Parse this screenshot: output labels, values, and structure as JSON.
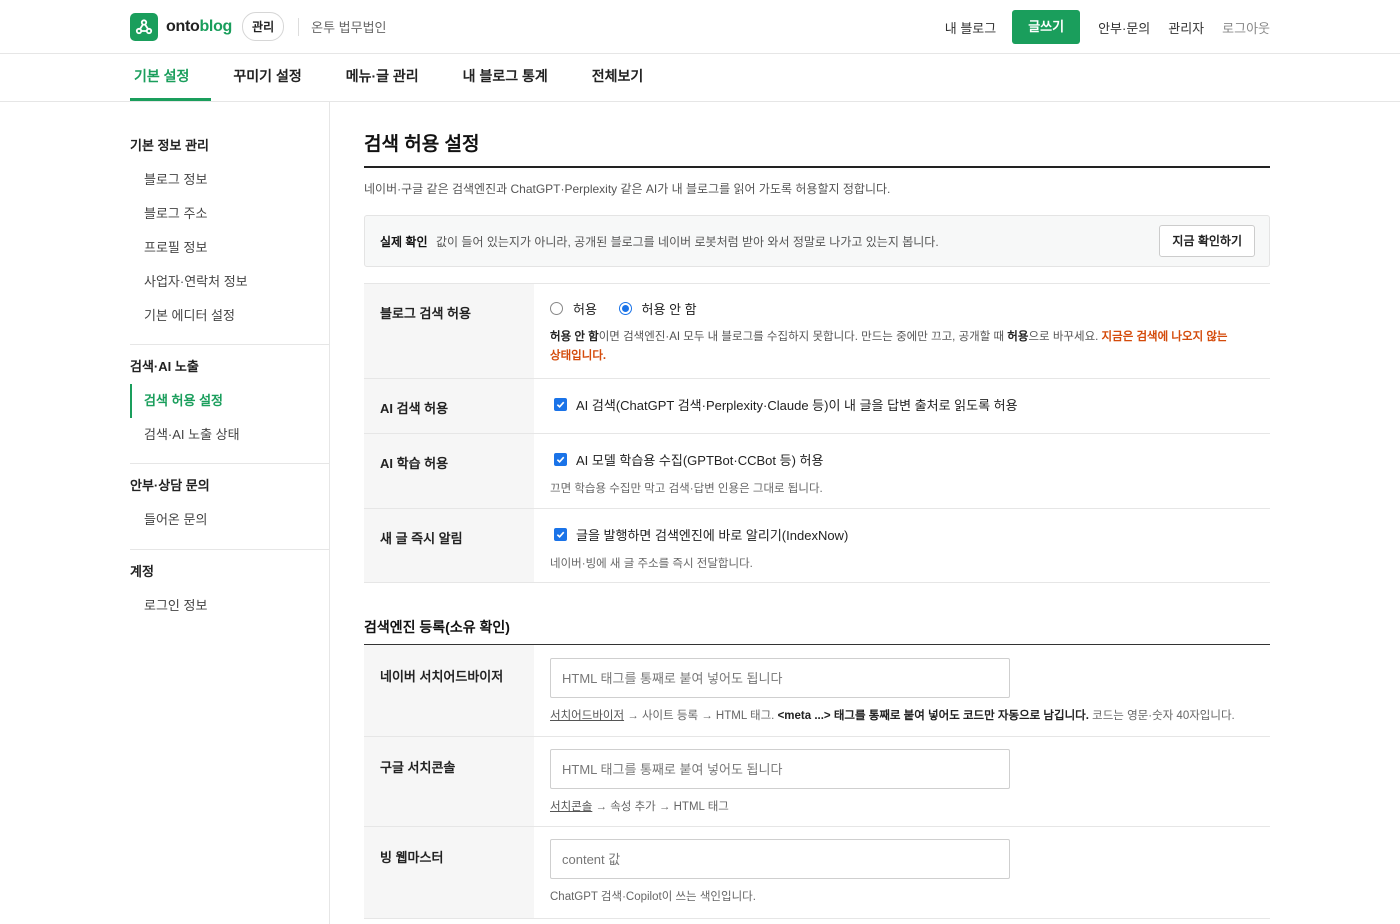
{
  "header": {
    "brand_prefix": "onto",
    "brand_suffix": "blog",
    "admin_badge": "관리",
    "org_name": "온투 법무법인",
    "links": [
      "내 블로그",
      "안부·문의",
      "관리자",
      "로그아웃"
    ],
    "write_button": "글쓰기"
  },
  "tabs": [
    "기본 설정",
    "꾸미기 설정",
    "메뉴·글 관리",
    "내 블로그 통계",
    "전체보기"
  ],
  "sidebar": {
    "groups": [
      {
        "title": "기본 정보 관리",
        "items": [
          "블로그 정보",
          "블로그 주소",
          "프로필 정보",
          "사업자·연락처 정보",
          "기본 에디터 설정"
        ]
      },
      {
        "title": "검색·AI 노출",
        "items": [
          "검색 허용 설정",
          "검색·AI 노출 상태"
        ]
      },
      {
        "title": "안부·상담 문의",
        "items": [
          "들어온 문의"
        ]
      },
      {
        "title": "계정",
        "items": [
          "로그인 정보"
        ]
      }
    ]
  },
  "main": {
    "title": "검색 허용 설정",
    "description": "네이버·구글 같은 검색엔진과 ChatGPT·Perplexity 같은 AI가 내 블로그를 읽어 가도록 허용할지 정합니다.",
    "check": {
      "label": "실제 확인",
      "text": "값이 들어 있는지가 아니라, 공개된 블로그를 네이버 로봇처럼 받아 와서 정말로 나가고 있는지 봅니다.",
      "button": "지금 확인하기"
    },
    "blog_search": {
      "label": "블로그 검색 허용",
      "option_allow": "허용",
      "option_deny": "허용 안 함",
      "note_b1": "허용 안 함",
      "note_t1": "이면 검색엔진·AI 모두 내 블로그를 수집하지 못합니다. 만드는 중에만 끄고, 공개할 때 ",
      "note_b2": "허용",
      "note_t2": "으로 바꾸세요. ",
      "note_warn": "지금은 검색에 나오지 않는 상태입니다."
    },
    "ai_search": {
      "label": "AI 검색 허용",
      "checkbox": "AI 검색(ChatGPT 검색·Perplexity·Claude 등)이 내 글을 답변 출처로 읽도록 허용"
    },
    "ai_training": {
      "label": "AI 학습 허용",
      "checkbox": "AI 모델 학습용 수집(GPTBot·CCBot 등) 허용",
      "hint": "끄면 학습용 수집만 막고 검색·답변 인용은 그대로 됩니다."
    },
    "indexnow": {
      "label": "새 글 즉시 알림",
      "checkbox": "글을 발행하면 검색엔진에 바로 알리기(IndexNow)",
      "hint": "네이버·빙에 새 글 주소를 즉시 전달합니다."
    },
    "registration": {
      "title": "검색엔진 등록(소유 확인)",
      "naver": {
        "label": "네이버 서치어드바이저",
        "placeholder": "HTML 태그를 통째로 붙여 넣어도 됩니다",
        "hint_link": "서치어드바이저",
        "hint_t1": " → 사이트 등록 → HTML 태그. ",
        "hint_b": "<meta ...> 태그를 통째로 붙여 넣어도 코드만 자동으로 남깁니다.",
        "hint_t2": " 코드는 영문·숫자 40자입니다."
      },
      "google": {
        "label": "구글 서치콘솔",
        "placeholder": "HTML 태그를 통째로 붙여 넣어도 됩니다",
        "hint_link": "서치콘솔",
        "hint_t1": " → 속성 추가 → HTML 태그"
      },
      "bing": {
        "label": "빙 웹마스터",
        "placeholder": "content 값",
        "hint": "ChatGPT 검색·Copilot이 쓰는 색인입니다."
      }
    }
  },
  "colors": {
    "brand_green": "#1a9e5c",
    "checkbox_blue": "#1a73e8",
    "warning_orange": "#d44b0b"
  },
  "icons": {
    "logo": "share-nodes-icon",
    "radio": "radio-icon",
    "checkbox": "checkmark-icon"
  }
}
